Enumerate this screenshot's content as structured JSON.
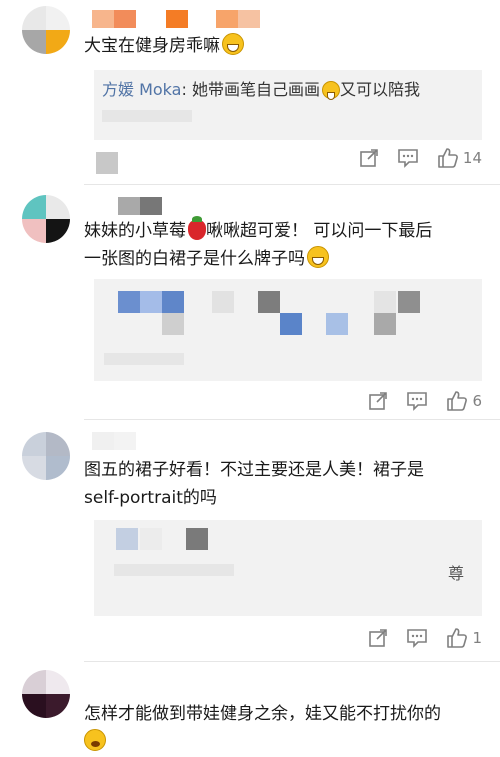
{
  "comments": [
    {
      "text_parts": [
        "大宝在健身房乖嘛"
      ],
      "reply": {
        "name": "方媛 Moka",
        "separator": ": ",
        "text": "她带画笔自己画画",
        "text2": "又可以陪我"
      },
      "like_count": "14"
    },
    {
      "text_parts": [
        "妹妹的小草莓",
        "啾啾超可爱！ 可以问一下最后",
        "一张图的白裙子是什么牌子吗"
      ],
      "like_count": "6"
    },
    {
      "text_parts": [
        "图五的裙子好看！不过主要还是人美！裙子是",
        "self-portrait的吗"
      ],
      "reply_snippet": "尊",
      "like_count": "1"
    },
    {
      "text_parts": [
        "怎样才能做到带娃健身之余，娃又能不打扰你的"
      ]
    }
  ],
  "icons": {
    "share": "share-icon",
    "comment": "comment-icon",
    "like": "thumbs-up-icon",
    "laugh_emoji": "laughing-emoji-icon",
    "strawberry_emoji": "strawberry-emoji-icon",
    "cry_emoji": "crying-emoji-icon"
  },
  "colors": {
    "reply_name": "#5174a6",
    "reply_bg": "#f2f2f2",
    "action_gray": "#808080"
  }
}
